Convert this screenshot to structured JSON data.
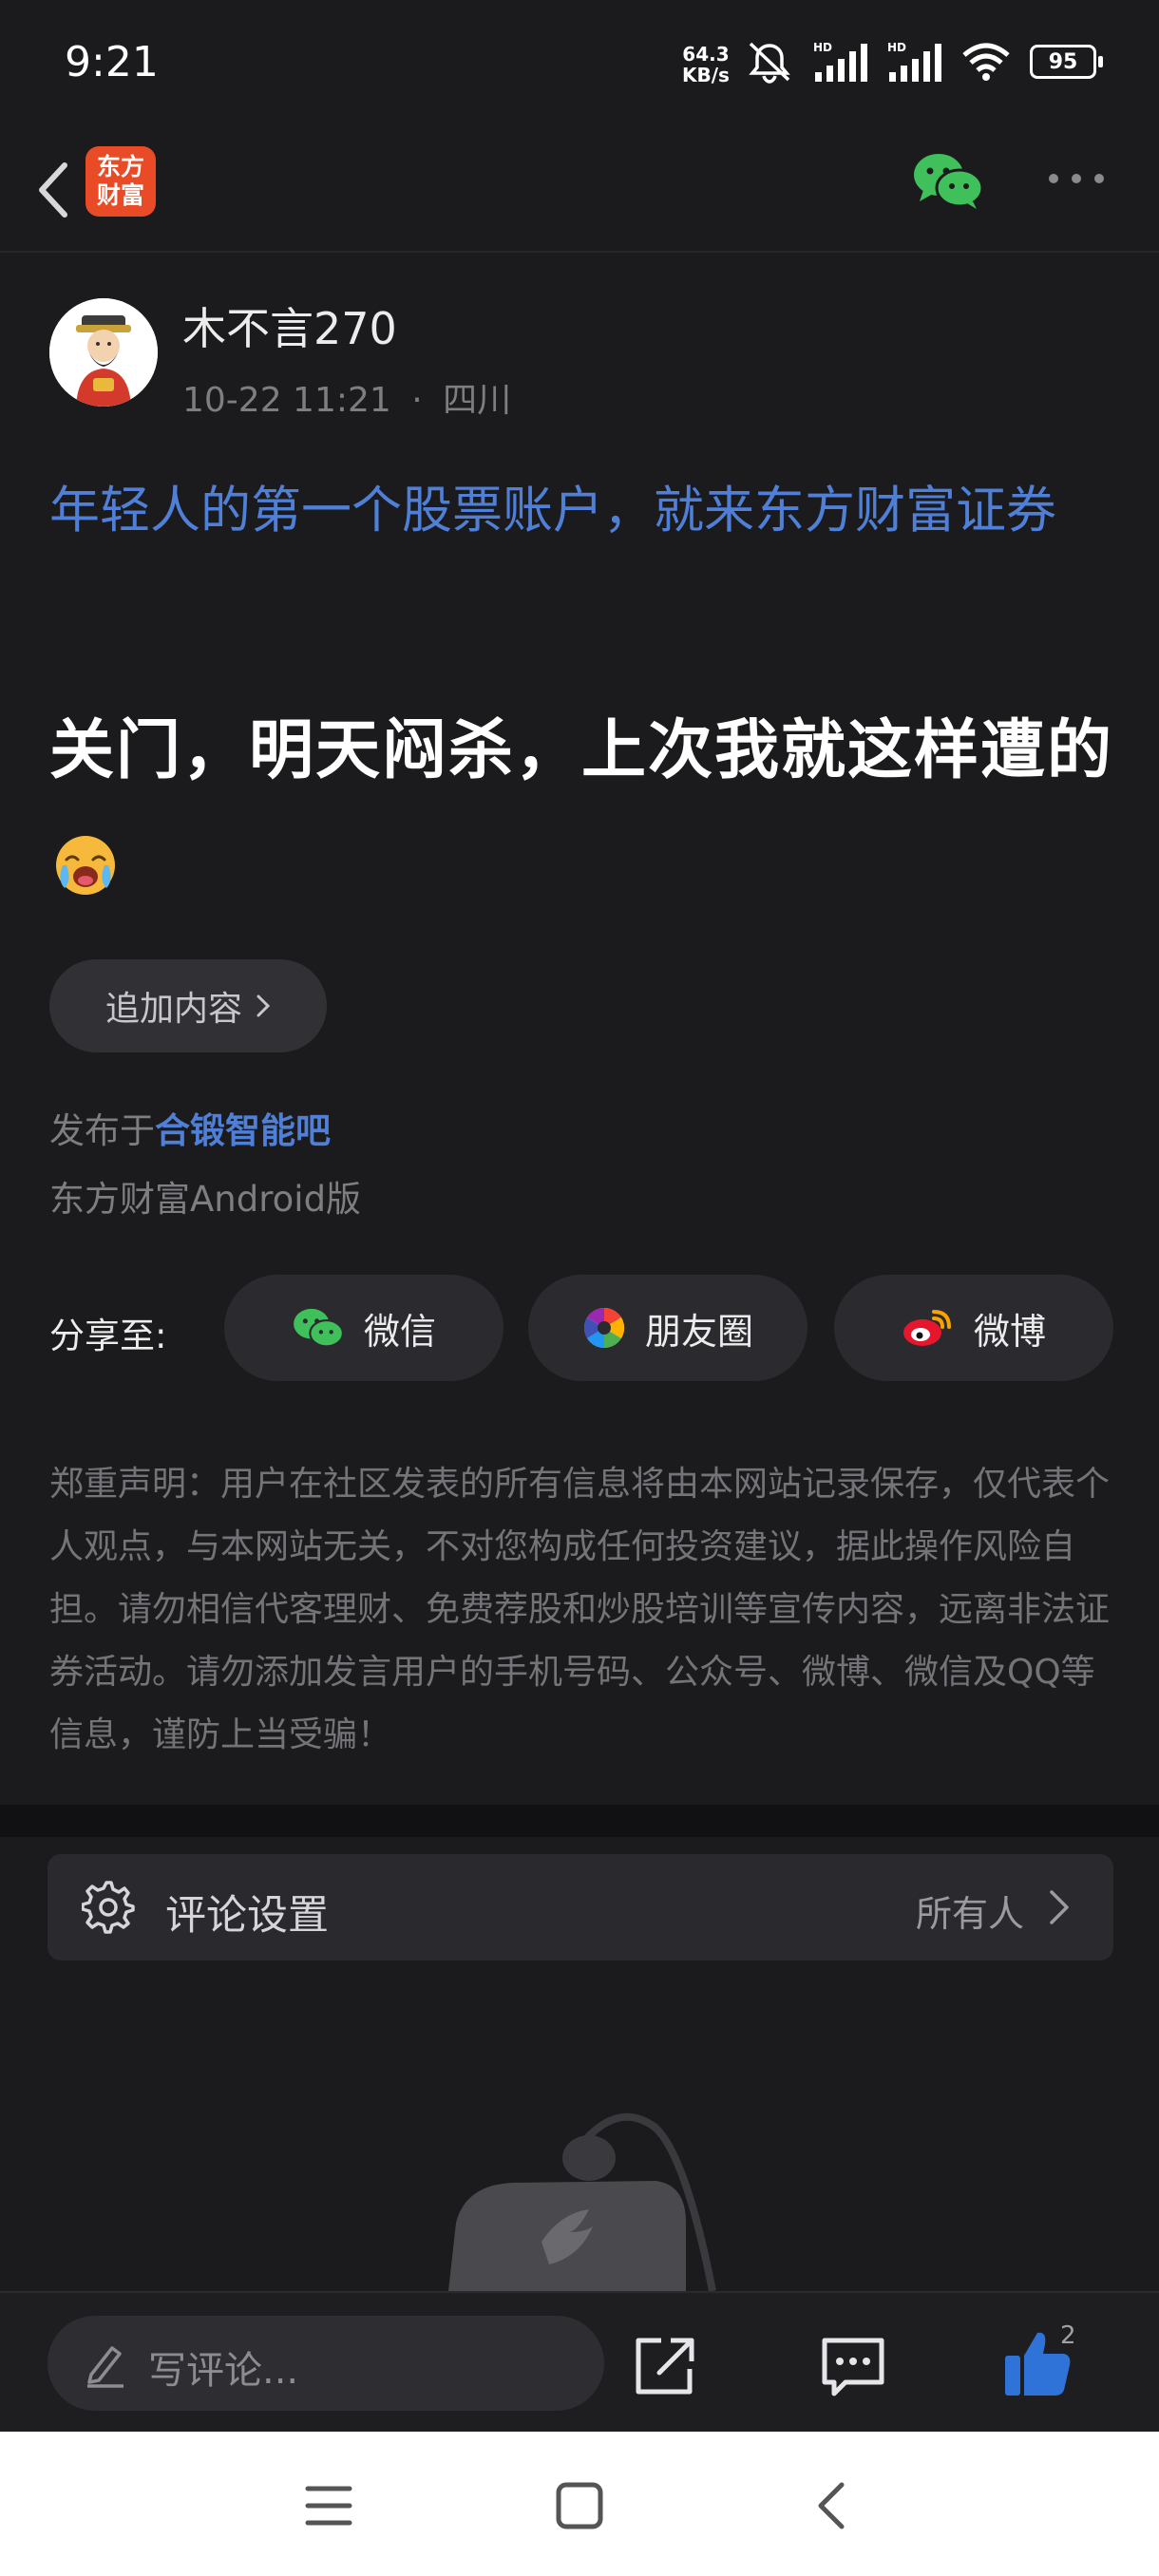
{
  "status_bar": {
    "time": "9:21",
    "net_speed_value": "64.3",
    "net_speed_unit": "KB/s",
    "battery": "95"
  },
  "nav": {
    "logo_line1": "东方",
    "logo_line2": "财富"
  },
  "post": {
    "author_name": "木不言270",
    "timestamp": "10-22 11:21",
    "location": "四川",
    "meta_separator": "·",
    "ad_link": "年轻人的第一个股票账户，就来东方财富证券",
    "title": "关门，明天闷杀，上次我就这样遭的",
    "append_label": "追加内容",
    "published_prefix": "发布于",
    "bar_name": "合锻智能吧",
    "client_version": "东方财富Android版"
  },
  "share": {
    "label": "分享至:",
    "buttons": [
      {
        "label": "微信",
        "icon": "wechat-icon"
      },
      {
        "label": "朋友圈",
        "icon": "moments-icon"
      },
      {
        "label": "微博",
        "icon": "weibo-icon"
      }
    ]
  },
  "disclaimer": "郑重声明：用户在社区发表的所有信息将由本网站记录保存，仅代表个人观点，与本网站无关，不对您构成任何投资建议，据此操作风险自担。请勿相信代客理财、免费荐股和炒股培训等宣传内容，远离非法证券活动。请勿添加发言用户的手机号码、公众号、微博、微信及QQ等信息，谨防上当受骗！",
  "comment_settings": {
    "title": "评论设置",
    "value": "所有人"
  },
  "bottom_bar": {
    "placeholder": "写评论...",
    "like_count": "2"
  },
  "colors": {
    "background": "#1b1b1d",
    "link_blue": "#4f7fd6",
    "brand_orange": "#e84b25",
    "wechat_green": "#3fc05a",
    "like_blue": "#2f73d9"
  }
}
